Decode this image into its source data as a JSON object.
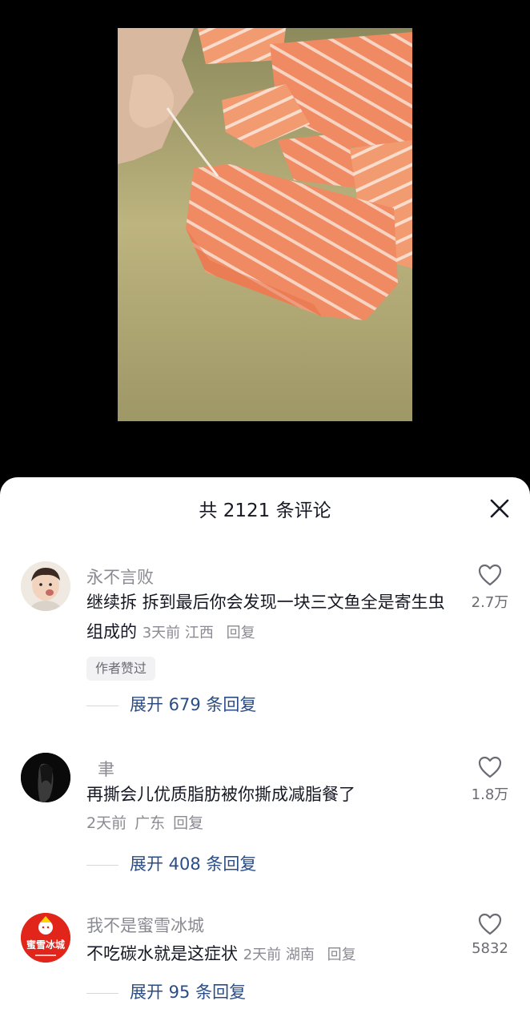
{
  "header": {
    "title": "共 2121 条评论"
  },
  "comments": [
    {
      "username": "永不言败",
      "text": "继续拆 拆到最后你会发现一块三文鱼全是寄生虫组成的",
      "time": "3天前",
      "location": "江西",
      "reply_label": "回复",
      "badge": "作者赞过",
      "likes": "2.7万",
      "expand_label": "展开 679 条回复"
    },
    {
      "username": "聿",
      "text": "再撕会儿优质脂肪被你撕成减脂餐了",
      "time": "2天前",
      "location": "广东",
      "reply_label": "回复",
      "likes": "1.8万",
      "expand_label": "展开 408 条回复"
    },
    {
      "username": "我不是蜜雪冰城",
      "text": "不吃碳水就是这症状",
      "time": "2天前",
      "location": "湖南",
      "reply_label": "回复",
      "likes": "5832",
      "expand_label": "展开 95 条回复",
      "avatar_text": "蜜雪冰城"
    }
  ],
  "colors": {
    "accent_link": "#2b4d86",
    "muted_text": "#8a8a92",
    "avatar_brand": "#e1251b"
  }
}
